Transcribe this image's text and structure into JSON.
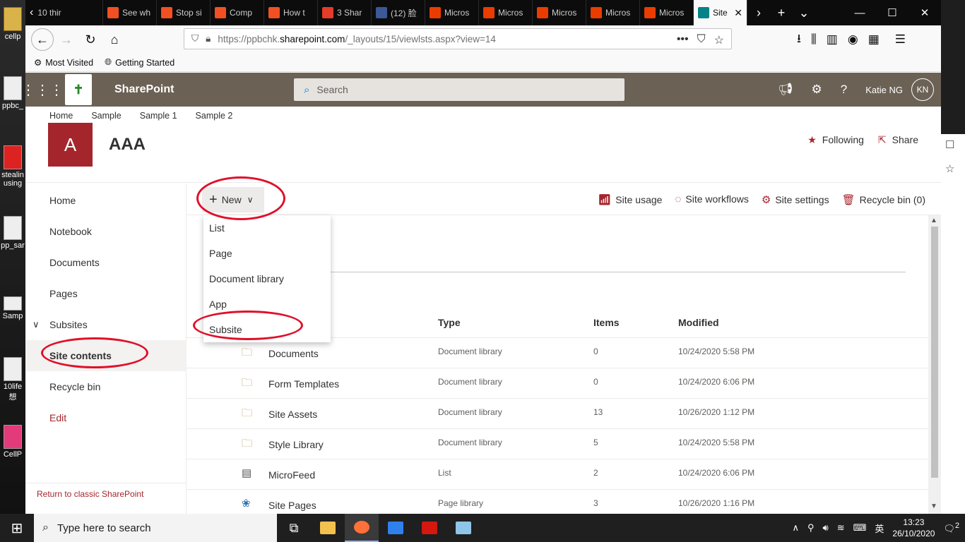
{
  "desktop": {
    "icons": [
      "cellp",
      "ppbc_",
      "stealin using",
      "pp_sar",
      "Samp",
      "10life 想",
      "CellP"
    ]
  },
  "browser": {
    "tabs": [
      {
        "label": "10 thir",
        "icon": "chevron-left-icon"
      },
      {
        "label": "See wh",
        "color": "#f25022"
      },
      {
        "label": "Stop si",
        "color": "#f25022"
      },
      {
        "label": "Comp",
        "color": "#f25022"
      },
      {
        "label": "How t",
        "color": "#f25022"
      },
      {
        "label": "3 Shar",
        "color": "#e23c2a"
      },
      {
        "label": "(12) 脸",
        "color": "#3b5998"
      },
      {
        "label": "Micros",
        "color": "#eb3c00"
      },
      {
        "label": "Micros",
        "color": "#eb3c00"
      },
      {
        "label": "Micros",
        "color": "#eb3c00"
      },
      {
        "label": "Micros",
        "color": "#eb3c00"
      },
      {
        "label": "Micros",
        "color": "#eb3c00"
      },
      {
        "label": "Site",
        "color": "#038387",
        "active": true
      }
    ],
    "url_prefix": "https://ppbchk.",
    "url_domain": "sharepoint.com",
    "url_path": "/_layouts/15/viewlsts.aspx?view=14",
    "bookmarks": [
      "Most Visited",
      "Getting Started"
    ]
  },
  "sharepoint": {
    "brand": "SharePoint",
    "search_placeholder": "Search",
    "user_name": "Katie NG",
    "user_initials": "KN",
    "top_nav": [
      "Home",
      "Sample",
      "Sample 1",
      "Sample 2"
    ],
    "site_logo_letter": "A",
    "site_title": "AAA",
    "following": "Following",
    "share": "Share"
  },
  "leftnav": {
    "items": [
      "Home",
      "Notebook",
      "Documents",
      "Pages",
      "Subsites",
      "Site contents",
      "Recycle bin",
      "Edit"
    ],
    "return_classic": "Return to classic SharePoint"
  },
  "commandbar": {
    "new_label": "New",
    "site_usage": "Site usage",
    "site_workflows": "Site workflows",
    "site_settings": "Site settings",
    "recycle_bin": "Recycle bin (0)"
  },
  "new_menu": [
    "List",
    "Page",
    "Document library",
    "App",
    "Subsite"
  ],
  "table": {
    "headers": {
      "type": "Type",
      "items": "Items",
      "modified": "Modified"
    },
    "rows": [
      {
        "name": "Documents",
        "type": "Document library",
        "items": "0",
        "modified": "10/24/2020 5:58 PM",
        "icon": "library"
      },
      {
        "name": "Form Templates",
        "type": "Document library",
        "items": "0",
        "modified": "10/24/2020 6:06 PM",
        "icon": "library"
      },
      {
        "name": "Site Assets",
        "type": "Document library",
        "items": "13",
        "modified": "10/26/2020 1:12 PM",
        "icon": "library"
      },
      {
        "name": "Style Library",
        "type": "Document library",
        "items": "5",
        "modified": "10/24/2020 5:58 PM",
        "icon": "library"
      },
      {
        "name": "MicroFeed",
        "type": "List",
        "items": "2",
        "modified": "10/24/2020 6:06 PM",
        "icon": "list"
      },
      {
        "name": "Site Pages",
        "type": "Page library",
        "items": "3",
        "modified": "10/26/2020 1:16 PM",
        "icon": "pages"
      }
    ]
  },
  "taskbar": {
    "search_placeholder": "Type here to search",
    "time": "13:23",
    "date": "26/10/2020",
    "ime": "英",
    "notifications": "2"
  }
}
